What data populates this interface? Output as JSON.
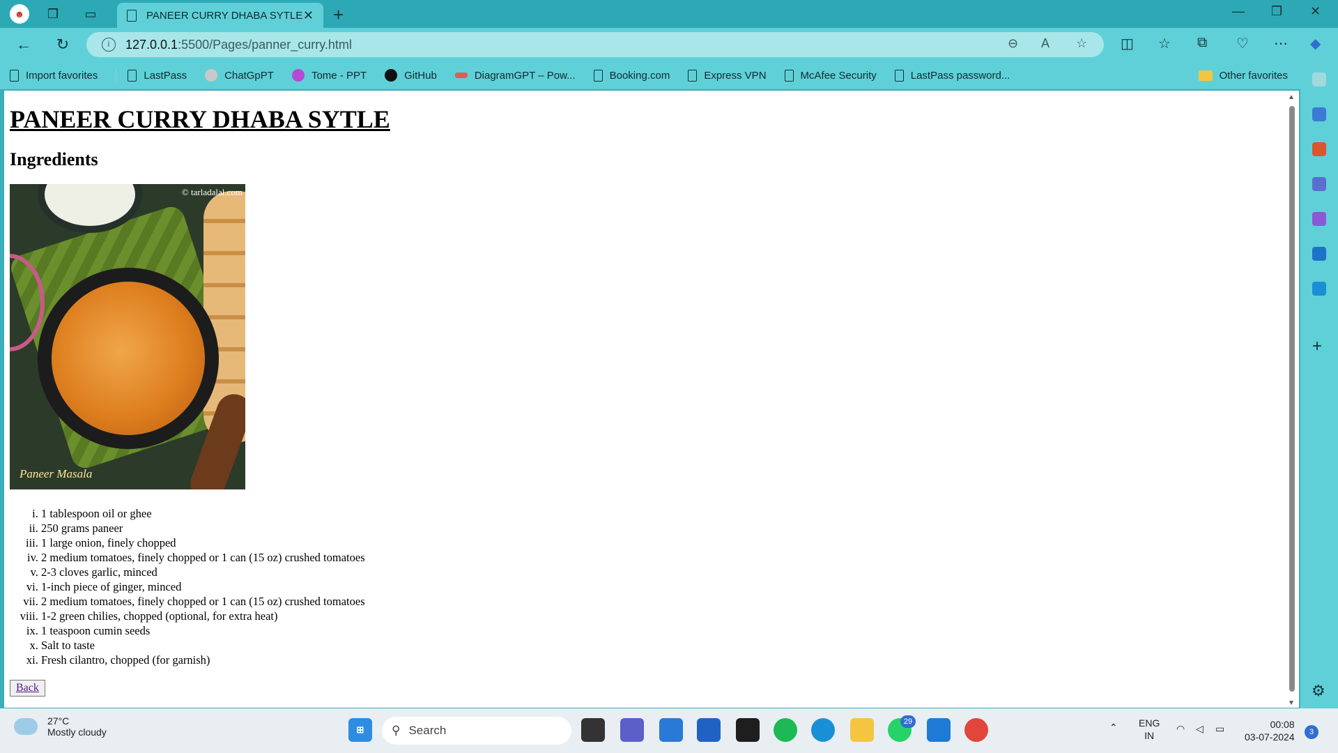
{
  "browser": {
    "tab_title": "PANEER CURRY DHABA SYTLE",
    "url_host": "127.0.0.1",
    "url_path": ":5500/Pages/panner_curry.html",
    "favorites": [
      "Import favorites",
      "LastPass",
      "ChatGpPT",
      "Tome - PPT",
      "GitHub",
      "DiagramGPT – Pow...",
      "Booking.com",
      "Express VPN",
      "McAfee Security",
      "LastPass password..."
    ],
    "other_favorites": "Other favorites"
  },
  "page": {
    "title": "PANEER CURRY DHABA SYTLE",
    "subtitle": "Ingredients",
    "image_watermark": "© tarladalal.com",
    "image_caption": "Paneer Masala",
    "ingredients": [
      "1 tablespoon oil or ghee",
      "250 grams paneer",
      "1 large onion, finely chopped",
      "2 medium tomatoes, finely chopped or 1 can (15 oz) crushed tomatoes",
      "2-3 cloves garlic, minced",
      "1-inch piece of ginger, minced",
      "2 medium tomatoes, finely chopped or 1 can (15 oz) crushed tomatoes",
      "1-2 green chilies, chopped (optional, for extra heat)",
      "1 teaspoon cumin seeds",
      "Salt to taste",
      "Fresh cilantro, chopped (for garnish)"
    ],
    "back_label": "Back"
  },
  "taskbar": {
    "temperature": "27°C",
    "weather": "Mostly cloudy",
    "search_placeholder": "Search",
    "whatsapp_badge": "29",
    "lang_top": "ENG",
    "lang_bottom": "IN",
    "time": "00:08",
    "date": "03-07-2024",
    "notifications": "3"
  },
  "colors": {
    "chrome": "#5fd0d8",
    "titlebar": "#2da9b5",
    "link": "#551a8b"
  }
}
